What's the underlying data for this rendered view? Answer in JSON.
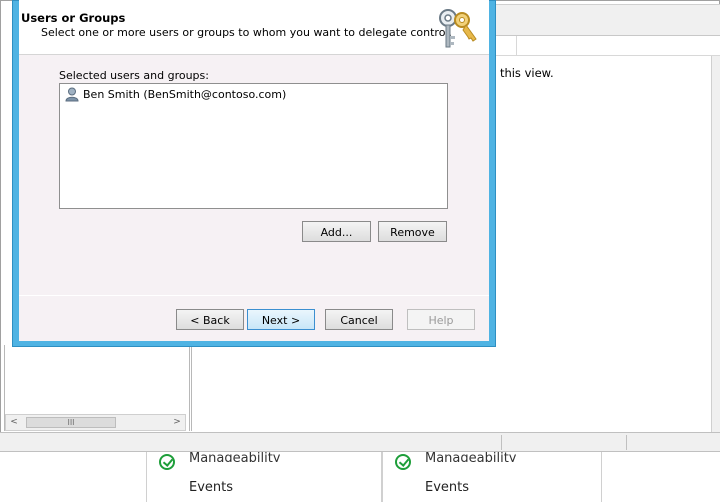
{
  "dialog": {
    "header_title": "Users or Groups",
    "header_subtitle": "Select one or more users or groups to whom you want to delegate control.",
    "icon": "keys-icon",
    "selected_label": "Selected users and groups:",
    "selected_items": [
      {
        "icon": "user-icon",
        "label": "Ben Smith (BenSmith@contoso.com)"
      }
    ],
    "buttons": {
      "add": "Add...",
      "remove": "Remove",
      "back": "< Back",
      "next": "Next >",
      "cancel": "Cancel",
      "help": "Help"
    }
  },
  "background": {
    "view_text": "n this view.",
    "scrollbar": {
      "left_arrow": "<",
      "right_arrow": ">",
      "thumb_grip": "III"
    },
    "tiles": [
      {
        "heading": "Manageability",
        "item": "Events"
      },
      {
        "heading": "Manageability",
        "item": "Events"
      }
    ]
  },
  "colors": {
    "dialog_frame": "#4fb3e3",
    "next_button_highlight": "#3c8fd0",
    "status_ok": "#1e9e3a"
  }
}
